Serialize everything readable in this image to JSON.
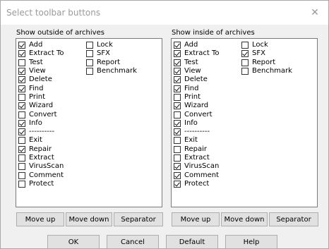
{
  "dialog": {
    "title": "Select toolbar buttons",
    "close_glyph": "✕"
  },
  "outside": {
    "label": "Show outside of archives",
    "col1": [
      {
        "label": "Add",
        "checked": true
      },
      {
        "label": "Extract To",
        "checked": true
      },
      {
        "label": "Test",
        "checked": false
      },
      {
        "label": "View",
        "checked": true
      },
      {
        "label": "Delete",
        "checked": true
      },
      {
        "label": "Find",
        "checked": true
      },
      {
        "label": "Print",
        "checked": false
      },
      {
        "label": "Wizard",
        "checked": true
      },
      {
        "label": "Convert",
        "checked": false
      },
      {
        "label": "Info",
        "checked": true
      },
      {
        "label": "----------",
        "checked": true
      },
      {
        "label": "Exit",
        "checked": false
      },
      {
        "label": "Repair",
        "checked": true
      },
      {
        "label": "Extract",
        "checked": false
      },
      {
        "label": "VirusScan",
        "checked": false
      },
      {
        "label": "Comment",
        "checked": false
      },
      {
        "label": "Protect",
        "checked": false
      }
    ],
    "col2": [
      {
        "label": "Lock",
        "checked": false
      },
      {
        "label": "SFX",
        "checked": false
      },
      {
        "label": "Report",
        "checked": false
      },
      {
        "label": "Benchmark",
        "checked": false
      }
    ],
    "buttons": {
      "move_up": "Move up",
      "move_down": "Move down",
      "separator": "Separator"
    }
  },
  "inside": {
    "label": "Show inside of archives",
    "col1": [
      {
        "label": "Add",
        "checked": true
      },
      {
        "label": "Extract To",
        "checked": true
      },
      {
        "label": "Test",
        "checked": true
      },
      {
        "label": "View",
        "checked": true
      },
      {
        "label": "Delete",
        "checked": true
      },
      {
        "label": "Find",
        "checked": true
      },
      {
        "label": "Print",
        "checked": false
      },
      {
        "label": "Wizard",
        "checked": true
      },
      {
        "label": "Convert",
        "checked": false
      },
      {
        "label": "Info",
        "checked": true
      },
      {
        "label": "----------",
        "checked": true
      },
      {
        "label": "Exit",
        "checked": false
      },
      {
        "label": "Repair",
        "checked": false
      },
      {
        "label": "Extract",
        "checked": false
      },
      {
        "label": "VirusScan",
        "checked": true
      },
      {
        "label": "Comment",
        "checked": true
      },
      {
        "label": "Protect",
        "checked": true
      }
    ],
    "col2": [
      {
        "label": "Lock",
        "checked": false
      },
      {
        "label": "SFX",
        "checked": true
      },
      {
        "label": "Report",
        "checked": false
      },
      {
        "label": "Benchmark",
        "checked": false
      }
    ],
    "buttons": {
      "move_up": "Move up",
      "move_down": "Move down",
      "separator": "Separator"
    }
  },
  "footer": {
    "ok": "OK",
    "cancel": "Cancel",
    "default": "Default",
    "help": "Help"
  }
}
